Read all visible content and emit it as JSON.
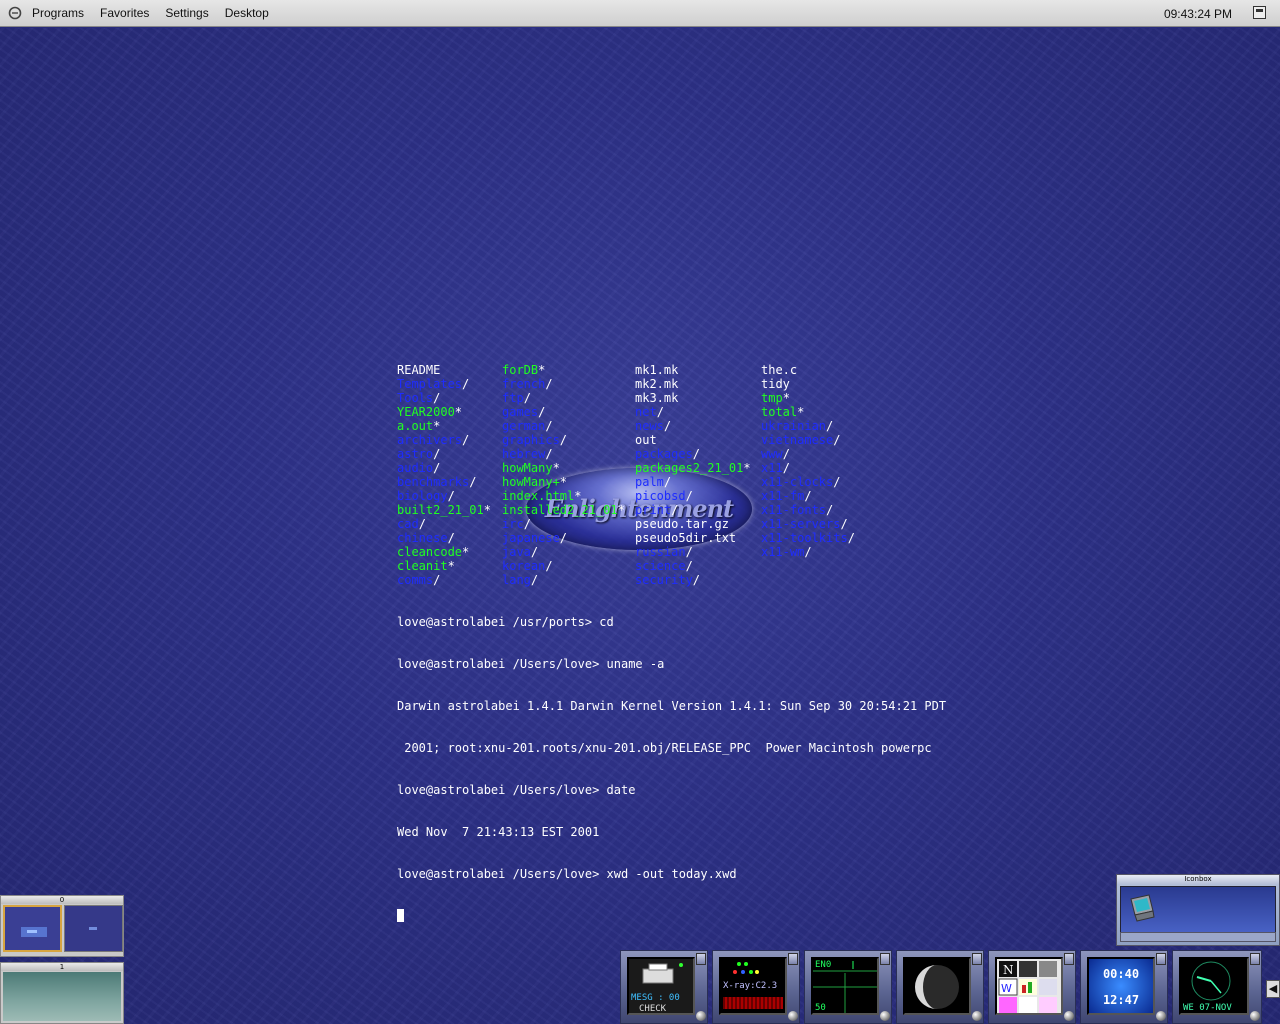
{
  "menubar": {
    "items": [
      "Programs",
      "Favorites",
      "Settings",
      "Desktop"
    ],
    "clock": "09:43:24 PM"
  },
  "terminal": {
    "ls_columns": [
      [
        {
          "t": "README",
          "c": "white",
          "s": ""
        },
        {
          "t": "Templates",
          "c": "blue",
          "s": "/"
        },
        {
          "t": "Tools",
          "c": "blue",
          "s": "/"
        },
        {
          "t": "YEAR2000",
          "c": "green",
          "s": "*"
        },
        {
          "t": "a.out",
          "c": "green",
          "s": "*"
        },
        {
          "t": "archivers",
          "c": "blue",
          "s": "/"
        },
        {
          "t": "astro",
          "c": "blue",
          "s": "/"
        },
        {
          "t": "audio",
          "c": "blue",
          "s": "/"
        },
        {
          "t": "benchmarks",
          "c": "blue",
          "s": "/"
        },
        {
          "t": "biology",
          "c": "blue",
          "s": "/"
        },
        {
          "t": "built2_21_01",
          "c": "green",
          "s": "*"
        },
        {
          "t": "cad",
          "c": "blue",
          "s": "/"
        },
        {
          "t": "chinese",
          "c": "blue",
          "s": "/"
        },
        {
          "t": "cleancode",
          "c": "green",
          "s": "*"
        },
        {
          "t": "cleanit",
          "c": "green",
          "s": "*"
        },
        {
          "t": "comms",
          "c": "blue",
          "s": "/"
        }
      ],
      [
        {
          "t": "forDB",
          "c": "green",
          "s": "*"
        },
        {
          "t": "french",
          "c": "blue",
          "s": "/"
        },
        {
          "t": "ftp",
          "c": "blue",
          "s": "/"
        },
        {
          "t": "games",
          "c": "blue",
          "s": "/"
        },
        {
          "t": "german",
          "c": "blue",
          "s": "/"
        },
        {
          "t": "graphics",
          "c": "blue",
          "s": "/"
        },
        {
          "t": "hebrew",
          "c": "blue",
          "s": "/"
        },
        {
          "t": "howMany",
          "c": "green",
          "s": "*"
        },
        {
          "t": "howMany+",
          "c": "green",
          "s": "*"
        },
        {
          "t": "index.html",
          "c": "green",
          "s": "*"
        },
        {
          "t": "installed2_21_01",
          "c": "green",
          "s": "*"
        },
        {
          "t": "irc",
          "c": "blue",
          "s": "/"
        },
        {
          "t": "japanese",
          "c": "blue",
          "s": "/"
        },
        {
          "t": "java",
          "c": "blue",
          "s": "/"
        },
        {
          "t": "korean",
          "c": "blue",
          "s": "/"
        },
        {
          "t": "lang",
          "c": "blue",
          "s": "/"
        }
      ],
      [
        {
          "t": "mk1.mk",
          "c": "white",
          "s": ""
        },
        {
          "t": "mk2.mk",
          "c": "white",
          "s": ""
        },
        {
          "t": "mk3.mk",
          "c": "white",
          "s": ""
        },
        {
          "t": "net",
          "c": "blue",
          "s": "/"
        },
        {
          "t": "news",
          "c": "blue",
          "s": "/"
        },
        {
          "t": "out",
          "c": "white",
          "s": ""
        },
        {
          "t": "packages",
          "c": "blue",
          "s": "/"
        },
        {
          "t": "packages2_21_01",
          "c": "green",
          "s": "*"
        },
        {
          "t": "palm",
          "c": "blue",
          "s": "/"
        },
        {
          "t": "picobsd",
          "c": "blue",
          "s": "/"
        },
        {
          "t": "print",
          "c": "blue",
          "s": "/"
        },
        {
          "t": "pseudo.tar.gz",
          "c": "white",
          "s": ""
        },
        {
          "t": "pseudo5dir.txt",
          "c": "white",
          "s": ""
        },
        {
          "t": "russian",
          "c": "blue",
          "s": "/"
        },
        {
          "t": "science",
          "c": "blue",
          "s": "/"
        },
        {
          "t": "security",
          "c": "blue",
          "s": "/"
        }
      ],
      [
        {
          "t": "the.c",
          "c": "white",
          "s": ""
        },
        {
          "t": "tidy",
          "c": "white",
          "s": ""
        },
        {
          "t": "tmp",
          "c": "green",
          "s": "*"
        },
        {
          "t": "total",
          "c": "green",
          "s": "*"
        },
        {
          "t": "ukrainian",
          "c": "blue",
          "s": "/"
        },
        {
          "t": "vietnamese",
          "c": "blue",
          "s": "/"
        },
        {
          "t": "www",
          "c": "blue",
          "s": "/"
        },
        {
          "t": "x11",
          "c": "blue",
          "s": "/"
        },
        {
          "t": "x11-clocks",
          "c": "blue",
          "s": "/"
        },
        {
          "t": "x11-fm",
          "c": "blue",
          "s": "/"
        },
        {
          "t": "x11-fonts",
          "c": "blue",
          "s": "/"
        },
        {
          "t": "x11-servers",
          "c": "blue",
          "s": "/"
        },
        {
          "t": "x11-toolkits",
          "c": "blue",
          "s": "/"
        },
        {
          "t": "x11-wm",
          "c": "blue",
          "s": "/"
        }
      ]
    ],
    "lines": [
      "love@astrolabei /usr/ports> cd",
      "love@astrolabei /Users/love> uname -a",
      "Darwin astrolabei 1.4.1 Darwin Kernel Version 1.4.1: Sun Sep 30 20:54:21 PDT",
      " 2001; root:xnu-201.roots/xnu-201.obj/RELEASE_PPC  Power Macintosh powerpc",
      "love@astrolabei /Users/love> date",
      "Wed Nov  7 21:43:13 EST 2001",
      "love@astrolabei /Users/love> xwd -out today.xwd"
    ]
  },
  "logo": {
    "text": "Enlightenment"
  },
  "pagers": [
    {
      "label": "0"
    },
    {
      "label": "1"
    }
  ],
  "iconbox": {
    "title": "Iconbox"
  },
  "dockapps": {
    "mail": {
      "line1": "MESG : 00",
      "line2": "CHECK"
    },
    "xray": {
      "line1": "X-ray:C2.3"
    },
    "net": {
      "label": "EN0",
      "value": "50"
    },
    "clock": {
      "time": "00:40",
      "time2": "12:47"
    },
    "analog": {
      "label": "WE 07-NOV"
    }
  },
  "colors": {
    "blue": "#1e2cff",
    "green": "#20ff20",
    "white": "#ffffff"
  }
}
